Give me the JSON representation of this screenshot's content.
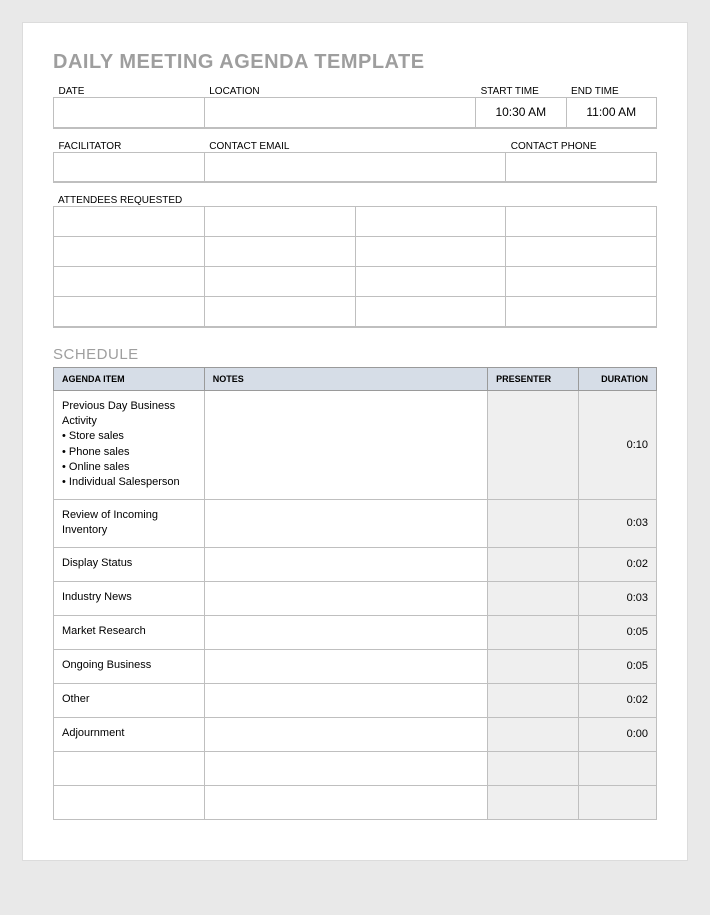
{
  "title": "DAILY MEETING AGENDA TEMPLATE",
  "info1": {
    "date_label": "DATE",
    "location_label": "LOCATION",
    "start_label": "START TIME",
    "end_label": "END TIME",
    "date": "",
    "location": "",
    "start": "10:30 AM",
    "end": "11:00 AM"
  },
  "info2": {
    "facilitator_label": "FACILITATOR",
    "email_label": "CONTACT EMAIL",
    "phone_label": "CONTACT PHONE",
    "facilitator": "",
    "email": "",
    "phone": ""
  },
  "attendees_label": "ATTENDEES REQUESTED",
  "schedule_label": "SCHEDULE",
  "sched_headers": {
    "item": "AGENDA ITEM",
    "notes": "NOTES",
    "presenter": "PRESENTER",
    "duration": "DURATION"
  },
  "rows": [
    {
      "item": "Previous Day Business Activity\n• Store sales\n• Phone sales\n• Online sales\n• Individual Salesperson",
      "notes": "",
      "presenter": "",
      "duration": "0:10",
      "big": true
    },
    {
      "item": "Review of Incoming Inventory",
      "notes": "",
      "presenter": "",
      "duration": "0:03"
    },
    {
      "item": "Display Status",
      "notes": "",
      "presenter": "",
      "duration": "0:02"
    },
    {
      "item": "Industry News",
      "notes": "",
      "presenter": "",
      "duration": "0:03"
    },
    {
      "item": "Market Research",
      "notes": "",
      "presenter": "",
      "duration": "0:05"
    },
    {
      "item": "Ongoing Business",
      "notes": "",
      "presenter": "",
      "duration": "0:05"
    },
    {
      "item": "Other",
      "notes": "",
      "presenter": "",
      "duration": "0:02"
    },
    {
      "item": "Adjournment",
      "notes": "",
      "presenter": "",
      "duration": "0:00"
    },
    {
      "item": "",
      "notes": "",
      "presenter": "",
      "duration": ""
    },
    {
      "item": "",
      "notes": "",
      "presenter": "",
      "duration": ""
    }
  ]
}
